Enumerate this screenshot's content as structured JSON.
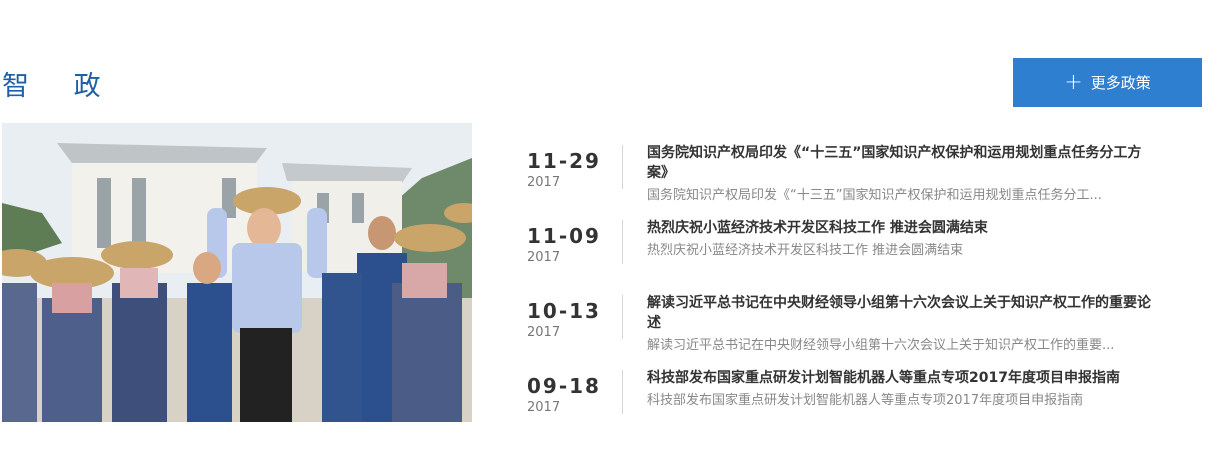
{
  "section": {
    "title": "智 政",
    "more_label": "更多政策",
    "more_icon": "plus-icon"
  },
  "colors": {
    "title": "#1f5fa5",
    "button_bg": "#2f7fd0",
    "date_text": "#333333",
    "summary_text": "#888888"
  },
  "news": [
    {
      "date_md": "11-29",
      "year": "2017",
      "title": "国务院知识产权局印发《“十三五”国家知识产权保护和运用规划重点任务分工方案》",
      "summary": "国务院知识产权局印发《“十三五”国家知识产权保护和运用规划重点任务分工..."
    },
    {
      "date_md": "11-09",
      "year": "2017",
      "title": "热烈庆祝小蓝经济技术开发区科技工作 推进会圆满结束",
      "summary": "热烈庆祝小蓝经济技术开发区科技工作 推进会圆满结束"
    },
    {
      "date_md": "10-13",
      "year": "2017",
      "title": "解读习近平总书记在中央财经领导小组第十六次会议上关于知识产权工作的重要论述",
      "summary": "解读习近平总书记在中央财经领导小组第十六次会议上关于知识产权工作的重要..."
    },
    {
      "date_md": "09-18",
      "year": "2017",
      "title": "科技部发布国家重点研发计划智能机器人等重点专项2017年度项目申报指南",
      "summary": "科技部发布国家重点研发计划智能机器人等重点专项2017年度项目申报指南"
    }
  ]
}
